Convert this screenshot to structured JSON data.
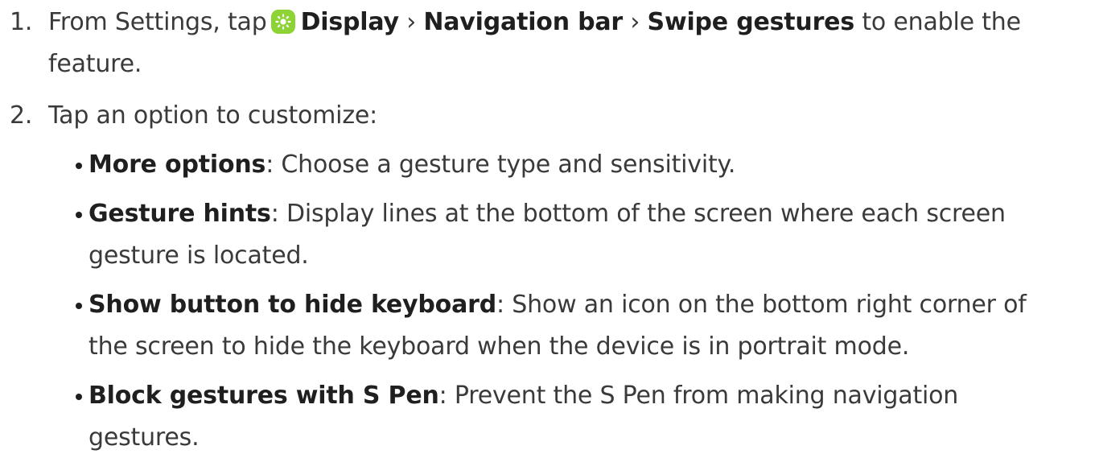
{
  "step1": {
    "number": "1.",
    "prefix": "From Settings, tap",
    "icon": "display-settings-icon",
    "path1": "Display",
    "sep1": "›",
    "path2": "Navigation bar",
    "sep2": "›",
    "path3": "Swipe gestures",
    "suffix": "to enable the",
    "continuation": "feature."
  },
  "step2": {
    "number": "2.",
    "text": "Tap an option to customize:"
  },
  "options": [
    {
      "title": "More options",
      "desc": ": Choose a gesture type and sensitivity."
    },
    {
      "title": "Gesture hints",
      "desc": ": Display lines at the bottom of the screen where each screen",
      "continuation": "gesture is located."
    },
    {
      "title": "Show button to hide keyboard",
      "desc": ": Show an icon on the bottom right corner of",
      "continuation": "the screen to hide the keyboard when the device is in portrait mode."
    },
    {
      "title": "Block gestures with S Pen",
      "desc": ": Prevent the S Pen from making navigation",
      "continuation": "gestures."
    }
  ],
  "colors": {
    "text": "#3a3a3a",
    "bold": "#1f1f1f",
    "icon_bg": "#8dd335"
  }
}
